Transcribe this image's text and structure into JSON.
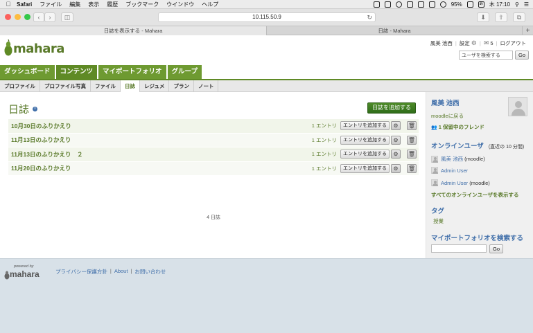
{
  "os_menubar": {
    "app_name": "Safari",
    "menus": [
      "ファイル",
      "編集",
      "表示",
      "履歴",
      "ブックマーク",
      "ウインドウ",
      "ヘルプ"
    ],
    "battery": "95%",
    "clock": "木 17:10",
    "input_method": "あ"
  },
  "browser": {
    "url": "10.115.50.9",
    "tabs": [
      {
        "title": "日誌を表示する - Mahara",
        "active": true
      },
      {
        "title": "日誌 - Mahara",
        "active": false
      }
    ]
  },
  "site": {
    "logo_text": "mahara",
    "user_name": "風美 池西",
    "settings_label": "設定",
    "inbox_count": "5",
    "logout_label": "ログアウト",
    "user_search_placeholder": "ユーザを検索する",
    "go_label": "Go"
  },
  "main_nav": [
    {
      "label": "ダッシュボード",
      "active": false
    },
    {
      "label": "コンテンツ",
      "active": true
    },
    {
      "label": "マイポートフォリオ",
      "active": false
    },
    {
      "label": "グループ",
      "active": false
    }
  ],
  "sub_nav": [
    {
      "label": "プロファイル",
      "active": false
    },
    {
      "label": "プロファイル写真",
      "active": false
    },
    {
      "label": "ファイル",
      "active": false
    },
    {
      "label": "日誌",
      "active": true
    },
    {
      "label": "レジュメ",
      "active": false
    },
    {
      "label": "プラン",
      "active": false
    },
    {
      "label": "ノート",
      "active": false
    }
  ],
  "journals": {
    "heading": "日誌",
    "add_button": "日誌を追加する",
    "items": [
      {
        "title": "10月30日のふりかえり",
        "count": "1 エントリ",
        "add_entry": "エントリを追加する"
      },
      {
        "title": "11月13日のふりかえり",
        "count": "1 エントリ",
        "add_entry": "エントリを追加する"
      },
      {
        "title": "11月13日のふりかえり　２",
        "count": "1 エントリ",
        "add_entry": "エントリを追加する"
      },
      {
        "title": "11月20日のふりかえり",
        "count": "1 エントリ",
        "add_entry": "エントリを追加する"
      }
    ],
    "total": "4 日誌"
  },
  "sidebar": {
    "profile_name": "風美 池西",
    "back_link": "moodleに戻る",
    "pending_friends": "1 保留中のフレンド",
    "online_title": "オンラインユーザ",
    "online_note": "(直近の 10 分間)",
    "online_users": [
      {
        "name": "風美 池西",
        "suffix": "(moodle)"
      },
      {
        "name": "Admin User",
        "suffix": ""
      },
      {
        "name": "Admin User",
        "suffix": "(moodle)"
      }
    ],
    "show_all_online": "すべてのオンラインユーザを表示する",
    "tags_title": "タグ",
    "tags": [
      "授業"
    ],
    "portfolio_search_title": "マイポートフォリオを検索する",
    "go_label": "Go"
  },
  "footer": {
    "powered_by": "powered by",
    "powered_logo": "mahara",
    "links": [
      "プライバシー保護方針",
      "About",
      "お問い合わせ"
    ]
  },
  "colors": {
    "green": "#6e9a31",
    "title_green": "#5a7a2a",
    "link_blue": "#3f6ea9"
  }
}
